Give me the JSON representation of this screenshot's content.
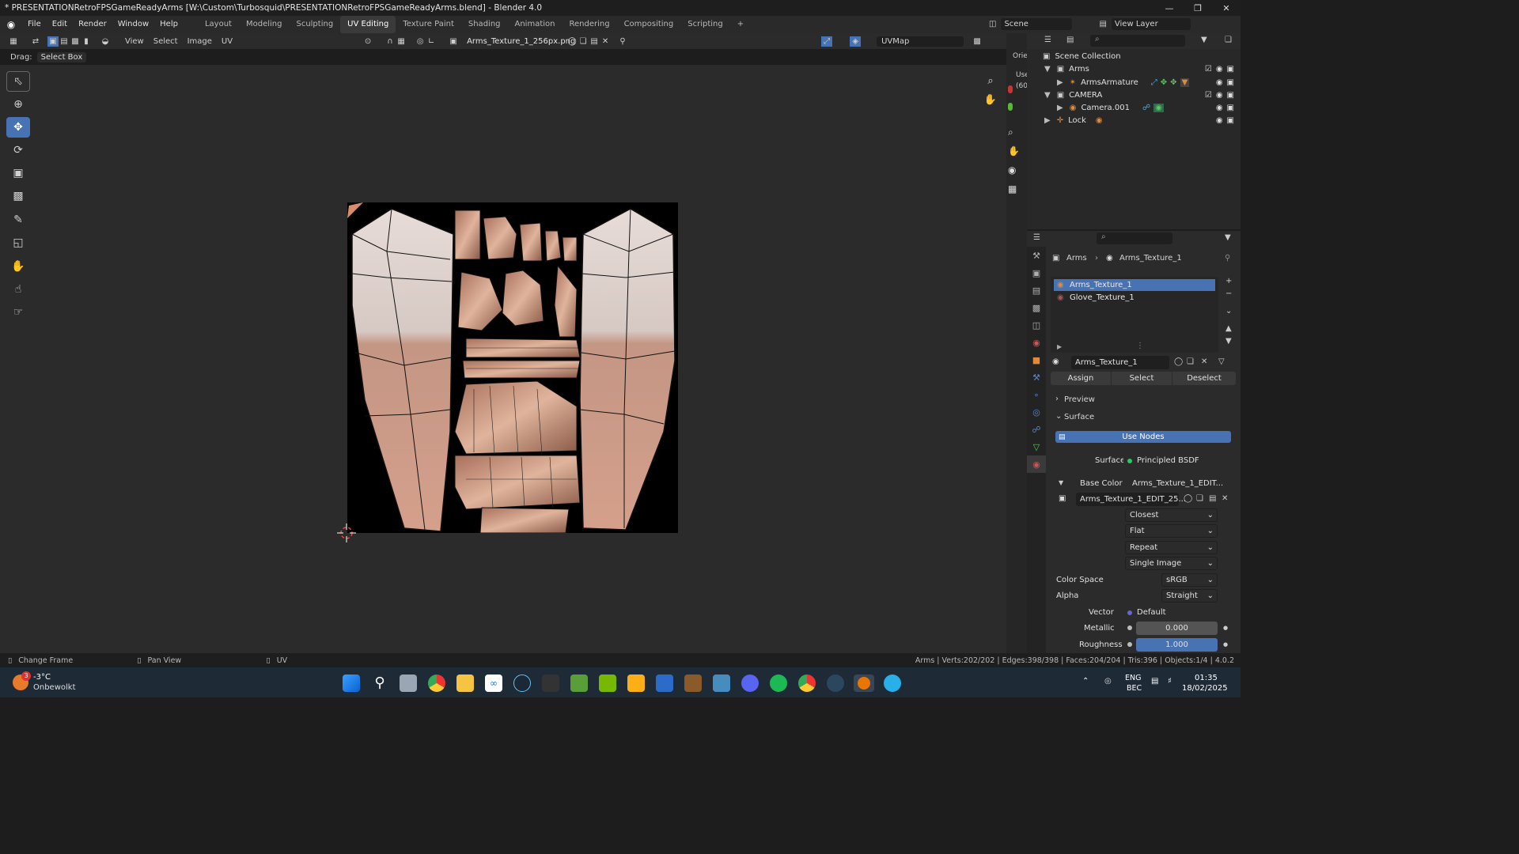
{
  "window": {
    "title": "* PRESENTATIONRetroFPSGameReadyArms [W:\\Custom\\Turbosquid\\PRESENTATIONRetroFPSGameReadyArms.blend] - Blender 4.0"
  },
  "menu": [
    "File",
    "Edit",
    "Render",
    "Window",
    "Help"
  ],
  "workspaces": [
    "Layout",
    "Modeling",
    "Sculpting",
    "UV Editing",
    "Texture Paint",
    "Shading",
    "Animation",
    "Rendering",
    "Compositing",
    "Scripting"
  ],
  "active_workspace": "UV Editing",
  "scene": {
    "scene_name": "Scene",
    "view_layer": "View Layer"
  },
  "uv_header": {
    "menus": [
      "View",
      "Select",
      "Image",
      "UV"
    ],
    "image_name": "Arms_Texture_1_256px.png",
    "uvmap": "UVMap"
  },
  "tool_header": {
    "drag_label": "Drag:",
    "drag_mode": "Select Box"
  },
  "outliner": {
    "collection_title": "Scene Collection",
    "items": [
      {
        "label": "Arms"
      },
      {
        "label": "ArmsArmature"
      },
      {
        "label": "CAMERA"
      },
      {
        "label": "Camera.001"
      },
      {
        "label": "Lock"
      }
    ]
  },
  "viewport_overlay": {
    "orientation": "Orie",
    "user_label": "Use",
    "user_sub": "(60"
  },
  "properties": {
    "breadcrumb_object": "Arms",
    "breadcrumb_material": "Arms_Texture_1",
    "materials": [
      "Arms_Texture_1",
      "Glove_Texture_1"
    ],
    "selected_material": "Arms_Texture_1",
    "material_field": "Arms_Texture_1",
    "assign": "Assign",
    "select": "Select",
    "deselect": "Deselect",
    "preview": "Preview",
    "surface_panel": "Surface",
    "use_nodes": "Use Nodes",
    "surface_label": "Surface",
    "surface_value": "Principled BSDF",
    "base_color_label": "Base Color",
    "base_color_value": "Arms_Texture_1_EDIT...",
    "image_field": "Arms_Texture_1_EDIT_25...",
    "interp": "Closest",
    "projection": "Flat",
    "extension": "Repeat",
    "source": "Single Image",
    "color_space_label": "Color Space",
    "color_space": "sRGB",
    "alpha_label": "Alpha",
    "alpha": "Straight",
    "vector_label": "Vector",
    "vector": "Default",
    "metallic_label": "Metallic",
    "metallic": "0.000",
    "roughness_label": "Roughness",
    "roughness": "1.000"
  },
  "status": {
    "left1": "Change Frame",
    "left2": "Pan View",
    "left3": "UV",
    "stats": "Arms | Verts:202/202 | Edges:398/398 | Faces:204/204 | Tris:396 | Objects:1/4 | 4.0.2"
  },
  "taskbar": {
    "weather_temp": "-3°C",
    "weather_desc": "Onbewolkt",
    "weather_badge": "3",
    "lang1": "ENG",
    "lang2": "BEC",
    "time": "01:35",
    "date": "18/02/2025"
  },
  "colors": {
    "accent": "#4772b3",
    "bg": "#2b2b2b"
  }
}
